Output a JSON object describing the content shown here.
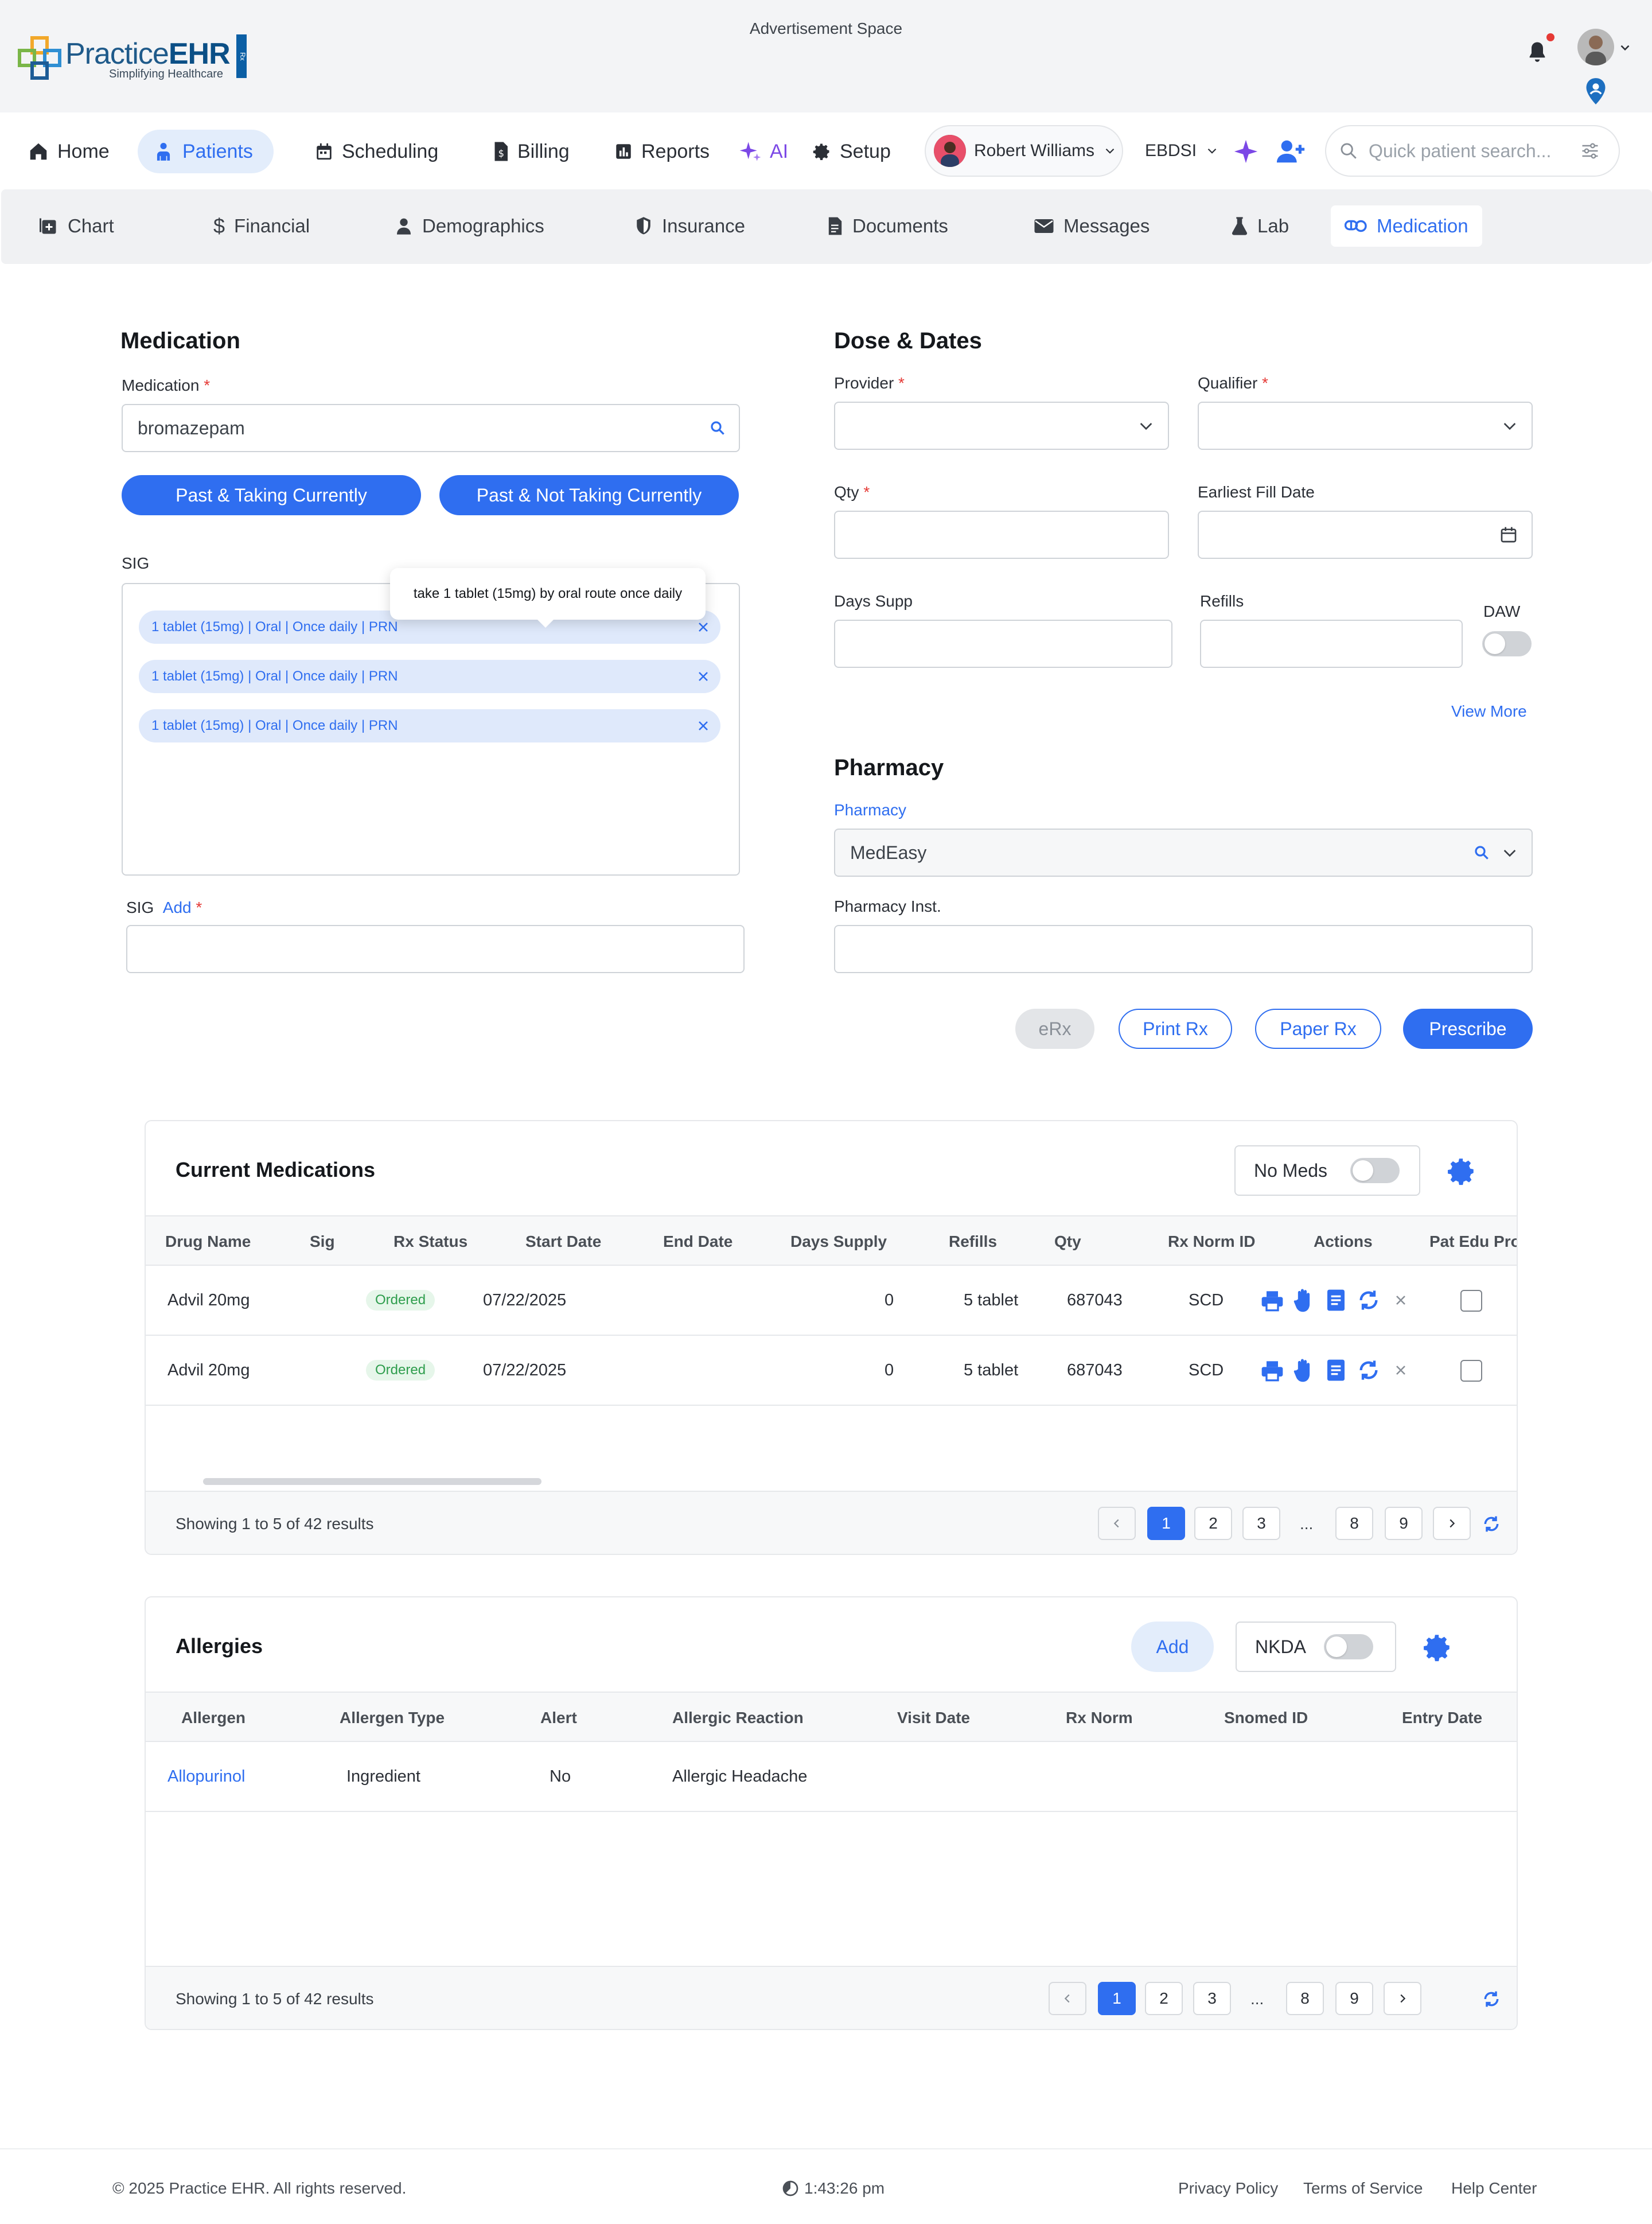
{
  "header": {
    "brand": {
      "practice": "Practice",
      "ehr": "EHR",
      "tagline": "Simplifying Healthcare",
      "side": "Rx"
    },
    "advertisement": "Advertisement Space"
  },
  "nav": {
    "items": [
      {
        "label": "Home",
        "icon": "home-icon"
      },
      {
        "label": "Patients",
        "icon": "patients-icon",
        "active": true
      },
      {
        "label": "Scheduling",
        "icon": "calendar-icon"
      },
      {
        "label": "Billing",
        "icon": "billing-icon"
      },
      {
        "label": "Reports",
        "icon": "reports-icon"
      },
      {
        "label": "AI",
        "icon": "ai-sparkle-icon"
      },
      {
        "label": "Setup",
        "icon": "gear-icon"
      }
    ],
    "user": "Robert Williams",
    "org": "EBDSI",
    "search_placeholder": "Quick patient search..."
  },
  "subnav": {
    "items": [
      {
        "label": "Chart",
        "icon": "chart-plus-icon"
      },
      {
        "label": "Financial",
        "icon": "dollar-icon"
      },
      {
        "label": "Demographics",
        "icon": "person-icon"
      },
      {
        "label": "Insurance",
        "icon": "shield-icon"
      },
      {
        "label": "Documents",
        "icon": "document-icon"
      },
      {
        "label": "Messages",
        "icon": "envelope-icon"
      },
      {
        "label": "Lab",
        "icon": "flask-icon"
      },
      {
        "label": "Medication",
        "icon": "pills-icon",
        "active": true
      }
    ]
  },
  "medication_form": {
    "title": "Medication",
    "medication_label": "Medication",
    "medication_value": "bromazepam",
    "btn_taking": "Past & Taking Currently",
    "btn_not_taking": "Past & Not Taking Currently",
    "sig_label": "SIG",
    "tooltip": "take 1 tablet (15mg) by oral route once daily",
    "sig_items": [
      "1 tablet (15mg) | Oral | Once daily | PRN",
      "1 tablet (15mg) | Oral | Once daily | PRN",
      "1 tablet (15mg) | Oral | Once daily | PRN"
    ],
    "sig_add_label": "SIG",
    "sig_add_link": "Add"
  },
  "dose_dates": {
    "title": "Dose & Dates",
    "provider": "Provider",
    "qualifier": "Qualifier",
    "qty": "Qty",
    "earliest_fill": "Earliest Fill Date",
    "days_supp": "Days Supp",
    "refills": "Refills",
    "daw": "DAW",
    "view_more": "View More"
  },
  "pharmacy": {
    "title": "Pharmacy",
    "label": "Pharmacy",
    "value": "MedEasy",
    "inst_label": "Pharmacy Inst."
  },
  "actions": {
    "erx": "eRx",
    "print": "Print Rx",
    "paper": "Paper Rx",
    "prescribe": "Prescribe"
  },
  "current_meds": {
    "title": "Current Medications",
    "no_meds": "No Meds",
    "columns": [
      "Drug Name",
      "Sig",
      "Rx Status",
      "Start Date",
      "End Date",
      "Days Supply",
      "Refills",
      "Qty",
      "Rx Norm ID",
      "Actions",
      "Pat Edu Pro"
    ],
    "rows": [
      {
        "drug": "Advil 20mg",
        "status": "Ordered",
        "start": "07/22/2025",
        "days": "0",
        "refills": "5 tablet",
        "qty": "687043",
        "norm": "SCD"
      },
      {
        "drug": "Advil 20mg",
        "status": "Ordered",
        "start": "07/22/2025",
        "days": "0",
        "refills": "5 tablet",
        "qty": "687043",
        "norm": "SCD"
      }
    ],
    "showing": "Showing 1 to 5 of 42 results",
    "pages": [
      "1",
      "2",
      "3",
      "...",
      "8",
      "9"
    ]
  },
  "allergies": {
    "title": "Allergies",
    "add": "Add",
    "nkda": "NKDA",
    "columns": [
      "Allergen",
      "Allergen Type",
      "Alert",
      "Allergic Reaction",
      "Visit Date",
      "Rx Norm",
      "Snomed ID",
      "Entry Date"
    ],
    "rows": [
      {
        "allergen": "Allopurinol",
        "type": "Ingredient",
        "alert": "No",
        "reaction": "Allergic Headache"
      }
    ],
    "showing": "Showing 1 to 5 of 42 results",
    "pages": [
      "1",
      "2",
      "3",
      "...",
      "8",
      "9"
    ]
  },
  "footer": {
    "copyright": "© 2025 Practice EHR. All rights reserved.",
    "time": "1:43:26 pm",
    "links": [
      "Privacy Policy",
      "Terms of Service",
      "Help Center"
    ]
  },
  "colors": {
    "accent": "#2f6ef0",
    "success": "#2e9d4d",
    "danger": "#e53935",
    "ai": "#7b48e6"
  }
}
